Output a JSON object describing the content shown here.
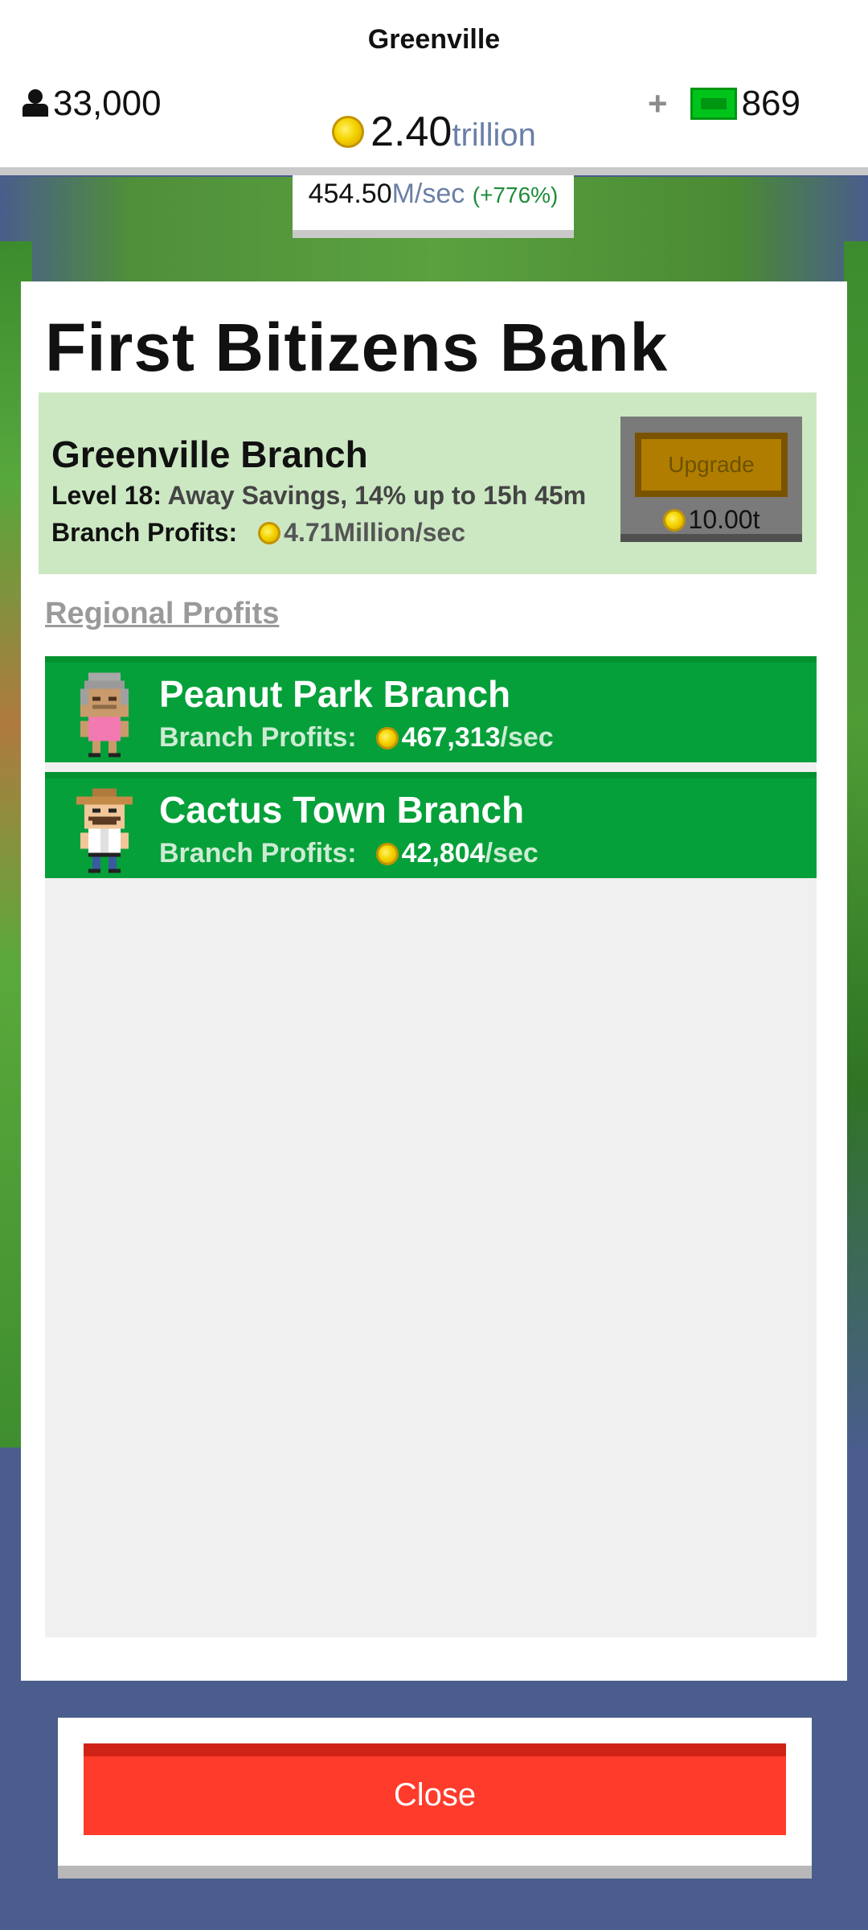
{
  "header": {
    "city": "Greenville",
    "population": "33,000",
    "money_value": "2.40",
    "money_unit": "trillion",
    "cash_plus": "+",
    "cash_amount": "869"
  },
  "rate": {
    "value": "454.50",
    "unit": "M/sec",
    "change": "(+776%)"
  },
  "bank": {
    "title": "First Bitizens Bank",
    "branch_name": "Greenville Branch",
    "level_label": "Level 18:",
    "level_desc": "Away Savings, 14% up to 15h 45m",
    "profits_label": "Branch Profits:",
    "profits_value": "4.71Million/sec",
    "upgrade_label": "Upgrade",
    "upgrade_cost": "10.00t"
  },
  "regional": {
    "title": "Regional Profits",
    "branches": [
      {
        "name": "Peanut Park Branch",
        "label": "Branch Profits:",
        "value": "467,313",
        "unit": "/sec"
      },
      {
        "name": "Cactus Town Branch",
        "label": "Branch Profits:",
        "value": "42,804",
        "unit": "/sec"
      }
    ]
  },
  "close_label": "Close",
  "colors": {
    "accent_green": "#05a03a",
    "close_red": "#ff3b2b",
    "branch_bg": "#cce8c3",
    "coin_gold": "#f5d300",
    "backdrop": "#4a5d8c"
  }
}
